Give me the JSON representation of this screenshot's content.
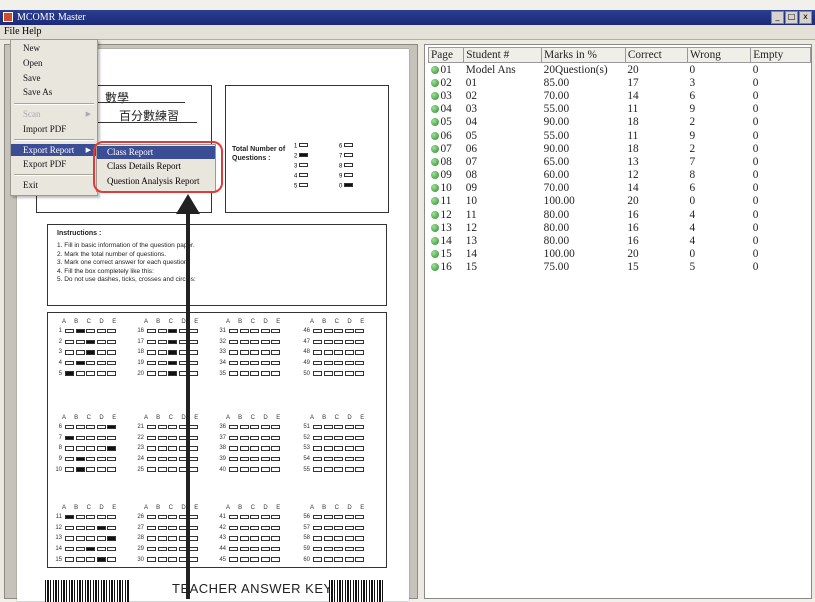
{
  "window": {
    "title": "MCOMR Master",
    "buttons": [
      "_",
      "□",
      "x"
    ]
  },
  "menubar": {
    "items": [
      "File",
      "Help"
    ]
  },
  "file_menu": {
    "items": [
      {
        "label": "New",
        "state": "normal"
      },
      {
        "label": "Open",
        "state": "normal"
      },
      {
        "label": "Save",
        "state": "normal"
      },
      {
        "label": "Save As",
        "state": "normal"
      },
      {
        "label": "Scan",
        "state": "disabled"
      },
      {
        "label": "Import PDF",
        "state": "normal"
      },
      {
        "label": "Export Report",
        "state": "active"
      },
      {
        "label": "Export PDF",
        "state": "normal"
      },
      {
        "label": "Exit",
        "state": "normal"
      }
    ],
    "submenu": [
      "Class Report",
      "Class Details Report",
      "Question Analysis Report"
    ]
  },
  "sheet": {
    "handwriting": {
      "subject": "數學",
      "sub_label": "百分數練習"
    },
    "total_questions_label": "Total Number of Questions :",
    "total_choices": [
      "1",
      "2",
      "3",
      "4",
      "5",
      "6",
      "7",
      "8",
      "9",
      "0"
    ],
    "instructions_title": "Instructions :",
    "instructions": [
      "1. Fill in basic information of the question paper.",
      "2. Mark the total number of questions.",
      "3. Mark one correct answer for each question.",
      "4. Fill the box completely like this:",
      "5. Do not use dashes, ticks, crosses and circles:"
    ],
    "option_letters": "A B C D E",
    "footer": "TEACHER ANSWER KEY"
  },
  "results": {
    "columns": [
      "Page",
      "Student #",
      "Marks in %",
      "Correct",
      "Wrong",
      "Empty"
    ],
    "rows": [
      [
        "01",
        "Model Ans",
        "20Question(s)",
        "20",
        "0",
        "0"
      ],
      [
        "02",
        "01",
        "85.00",
        "17",
        "3",
        "0"
      ],
      [
        "03",
        "02",
        "70.00",
        "14",
        "6",
        "0"
      ],
      [
        "04",
        "03",
        "55.00",
        "11",
        "9",
        "0"
      ],
      [
        "05",
        "04",
        "90.00",
        "18",
        "2",
        "0"
      ],
      [
        "06",
        "05",
        "55.00",
        "11",
        "9",
        "0"
      ],
      [
        "07",
        "06",
        "90.00",
        "18",
        "2",
        "0"
      ],
      [
        "08",
        "07",
        "65.00",
        "13",
        "7",
        "0"
      ],
      [
        "09",
        "08",
        "60.00",
        "12",
        "8",
        "0"
      ],
      [
        "10",
        "09",
        "70.00",
        "14",
        "6",
        "0"
      ],
      [
        "11",
        "10",
        "100.00",
        "20",
        "0",
        "0"
      ],
      [
        "12",
        "11",
        "80.00",
        "16",
        "4",
        "0"
      ],
      [
        "13",
        "12",
        "80.00",
        "16",
        "4",
        "0"
      ],
      [
        "14",
        "13",
        "80.00",
        "16",
        "4",
        "0"
      ],
      [
        "15",
        "14",
        "100.00",
        "20",
        "0",
        "0"
      ],
      [
        "16",
        "15",
        "75.00",
        "15",
        "5",
        "0"
      ]
    ]
  },
  "colors": {
    "accent": "#3b4d95",
    "highlight": "#e23a3a",
    "status_dot": "#2c8a2c"
  }
}
